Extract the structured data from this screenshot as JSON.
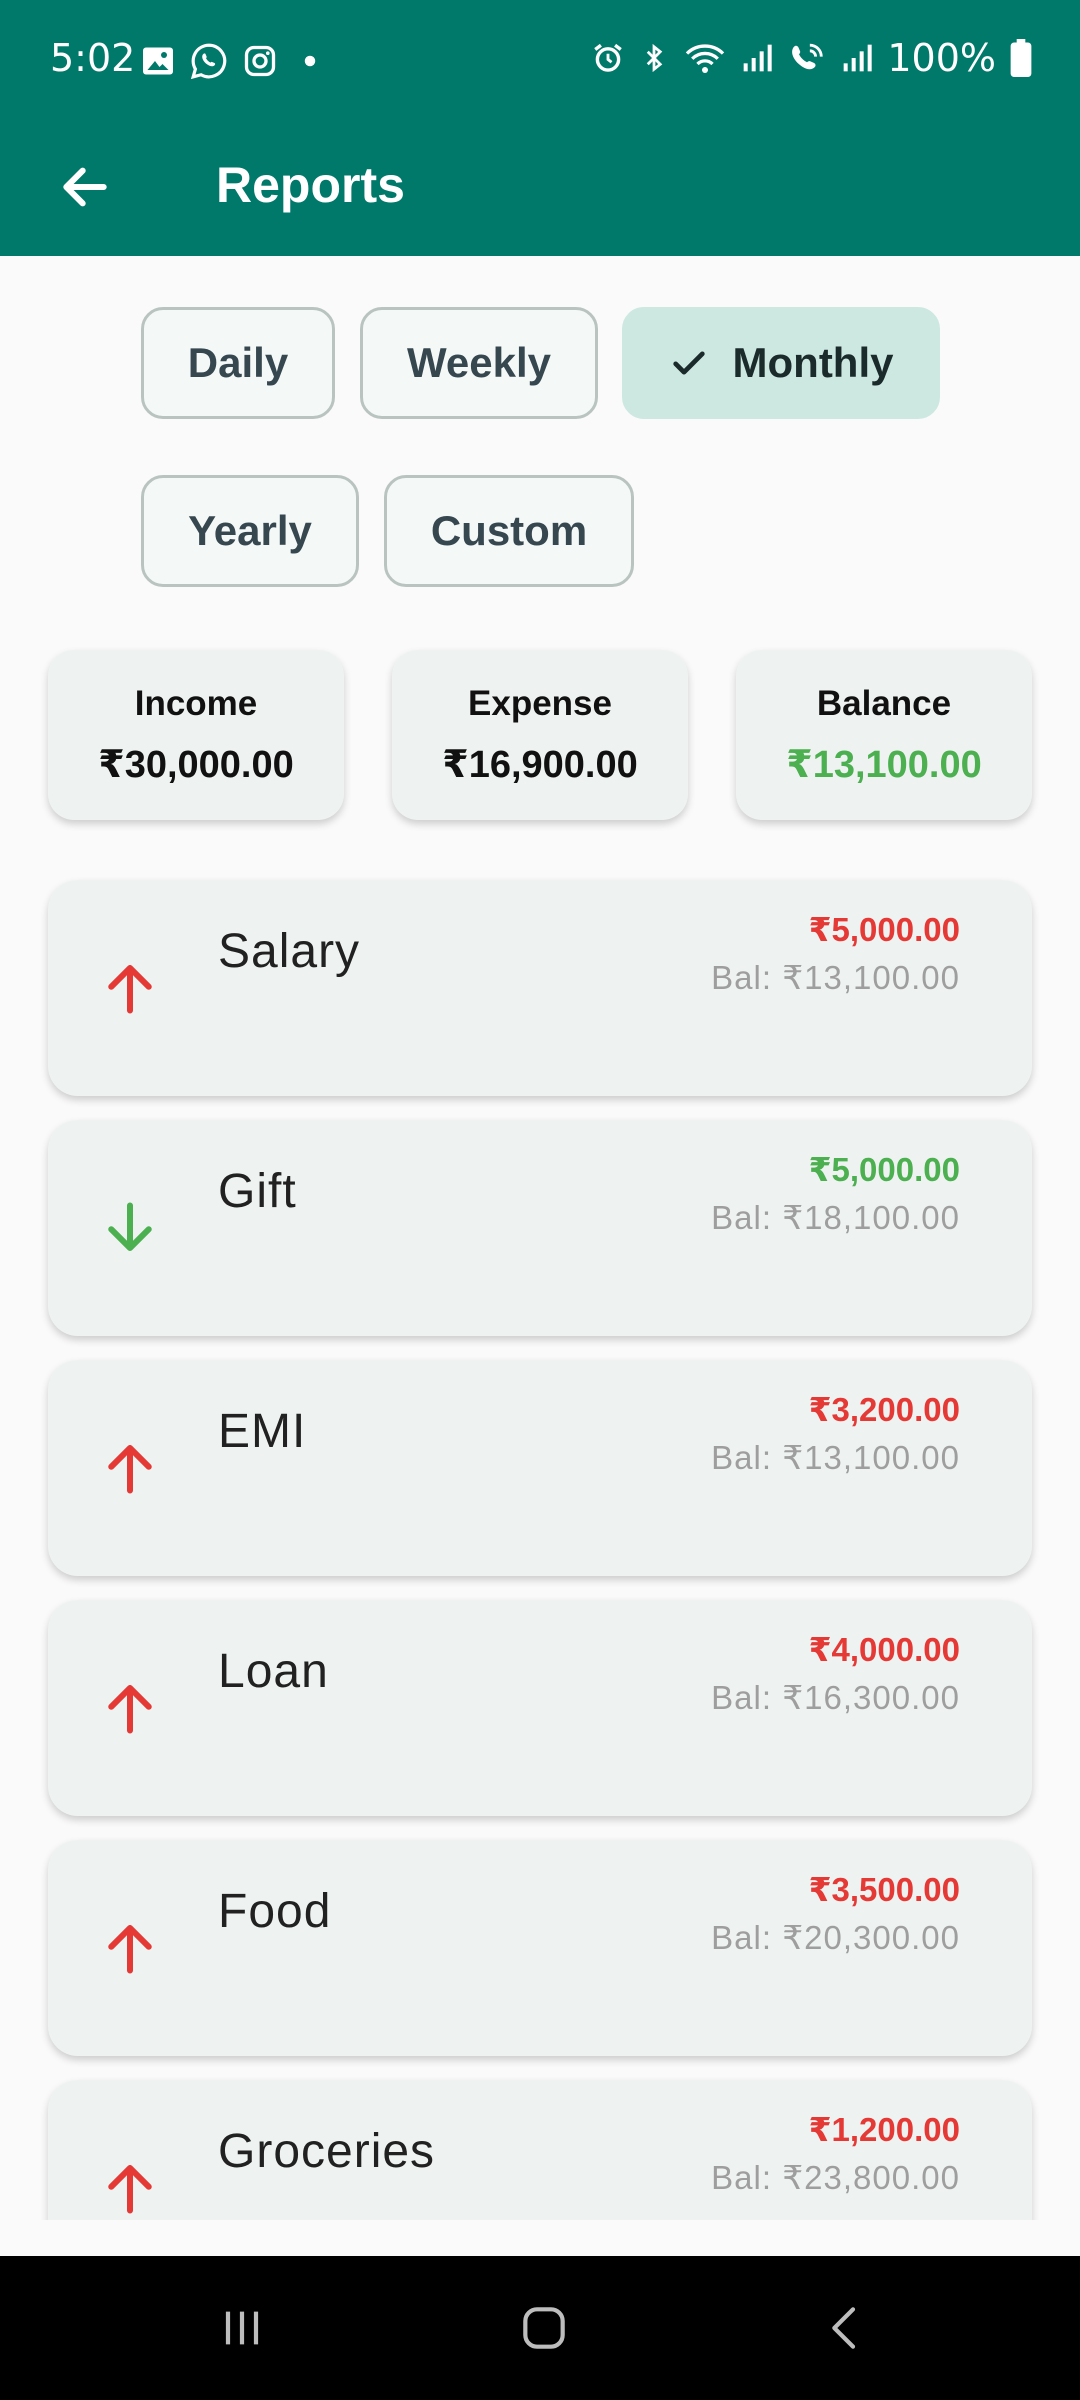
{
  "status_bar": {
    "time": "5:02",
    "battery": "100%",
    "icons_left": [
      "gallery-icon",
      "whatsapp-icon",
      "instagram-icon",
      "dot-icon"
    ],
    "icons_right": [
      "alarm-icon",
      "bluetooth-icon",
      "wifi-icon",
      "signal-icon",
      "wifi-call-icon",
      "signal-icon",
      "battery-icon"
    ]
  },
  "app_bar": {
    "title": "Reports",
    "back_icon": "arrow-left-icon"
  },
  "filters": {
    "chips": [
      {
        "label": "Daily",
        "selected": false
      },
      {
        "label": "Weekly",
        "selected": false
      },
      {
        "label": "Monthly",
        "selected": true
      },
      {
        "label": "Yearly",
        "selected": false
      },
      {
        "label": "Custom",
        "selected": false
      }
    ]
  },
  "summary": {
    "income": {
      "label": "Income",
      "value": "₹30,000.00"
    },
    "expense": {
      "label": "Expense",
      "value": "₹16,900.00"
    },
    "balance": {
      "label": "Balance",
      "value": "₹13,100.00"
    }
  },
  "transactions": [
    {
      "name": "Salary",
      "amount": "₹5,000.00",
      "balance": "Bal: ₹13,100.00",
      "direction": "up"
    },
    {
      "name": "Gift",
      "amount": "₹5,000.00",
      "balance": "Bal: ₹18,100.00",
      "direction": "down"
    },
    {
      "name": "EMI",
      "amount": "₹3,200.00",
      "balance": "Bal: ₹13,100.00",
      "direction": "up"
    },
    {
      "name": "Loan",
      "amount": "₹4,000.00",
      "balance": "Bal: ₹16,300.00",
      "direction": "up"
    },
    {
      "name": "Food",
      "amount": "₹3,500.00",
      "balance": "Bal: ₹20,300.00",
      "direction": "up"
    },
    {
      "name": "Groceries",
      "amount": "₹1,200.00",
      "balance": "Bal: ₹23,800.00",
      "direction": "up"
    }
  ],
  "colors": {
    "primary": "#00796b",
    "expense": "#e53935",
    "income": "#4caf50",
    "chip_selected": "#cde8e1"
  },
  "nav_bar": {
    "icons": [
      "recent-apps-icon",
      "home-icon",
      "back-icon"
    ]
  }
}
